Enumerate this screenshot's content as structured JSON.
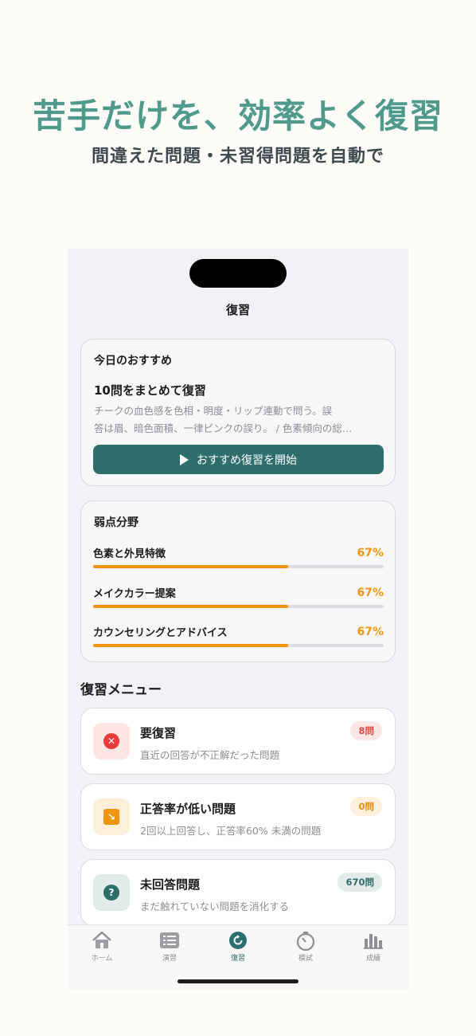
{
  "promo": {
    "headline": "苦手だけを、効率よく復習",
    "subheadline": "間違えた問題・未習得問題を自動で"
  },
  "screen": {
    "nav_title": "復習",
    "recommend": {
      "label": "今日のおすすめ",
      "title": "10問をまとめて復習",
      "desc_line1": "チークの血色感を色相・明度・リップ連動で問う。誤",
      "desc_line2": "答は眉、暗色面積、一律ピンクの誤り。 / 色素傾向の総…",
      "button_label": "おすすめ復習を開始",
      "button_icon": "play-icon"
    },
    "weak_areas": {
      "label": "弱点分野",
      "items": [
        {
          "name": "色素と外見特徴",
          "percent_label": "67%",
          "fraction": 0.67
        },
        {
          "name": "メイクカラー提案",
          "percent_label": "67%",
          "fraction": 0.67
        },
        {
          "name": "カウンセリングとアドバイス",
          "percent_label": "67%",
          "fraction": 0.67
        }
      ],
      "accent_color": "#f0950f"
    },
    "review_menu": {
      "title": "復習メニュー",
      "items": [
        {
          "title": "要復習",
          "subtitle": "直近の回答が不正解だった問題",
          "badge": "8問",
          "icon": "x-circle-icon",
          "glyph": "✕",
          "icon_color": "#ea3b3b",
          "icon_bg": "#fde6e4",
          "badge_color": "#e34848",
          "badge_bg": "#fde7e5"
        },
        {
          "title": "正答率が低い問題",
          "subtitle": "2回以上回答し、正答率60% 未満の問題",
          "badge": "0問",
          "icon": "chart-down-icon",
          "glyph": "↘",
          "icon_color": "#f0950f",
          "icon_bg": "#fdefd9",
          "badge_color": "#e8900f",
          "badge_bg": "#fdf0dc"
        },
        {
          "title": "未回答問題",
          "subtitle": "まだ触れていない問題を消化する",
          "badge": "670問",
          "icon": "question-circle-icon",
          "glyph": "?",
          "icon_color": "#2e6e6c",
          "icon_bg": "#e2ecea",
          "badge_color": "#2e6e6c",
          "badge_bg": "#e3eceb"
        }
      ]
    },
    "tabs": [
      {
        "label": "ホーム",
        "icon": "home-icon",
        "active": false
      },
      {
        "label": "演習",
        "icon": "list-icon",
        "active": false
      },
      {
        "label": "復習",
        "icon": "review-icon",
        "active": true
      },
      {
        "label": "模試",
        "icon": "timer-icon",
        "active": false
      },
      {
        "label": "成績",
        "icon": "bar-chart-icon",
        "active": false
      }
    ]
  }
}
